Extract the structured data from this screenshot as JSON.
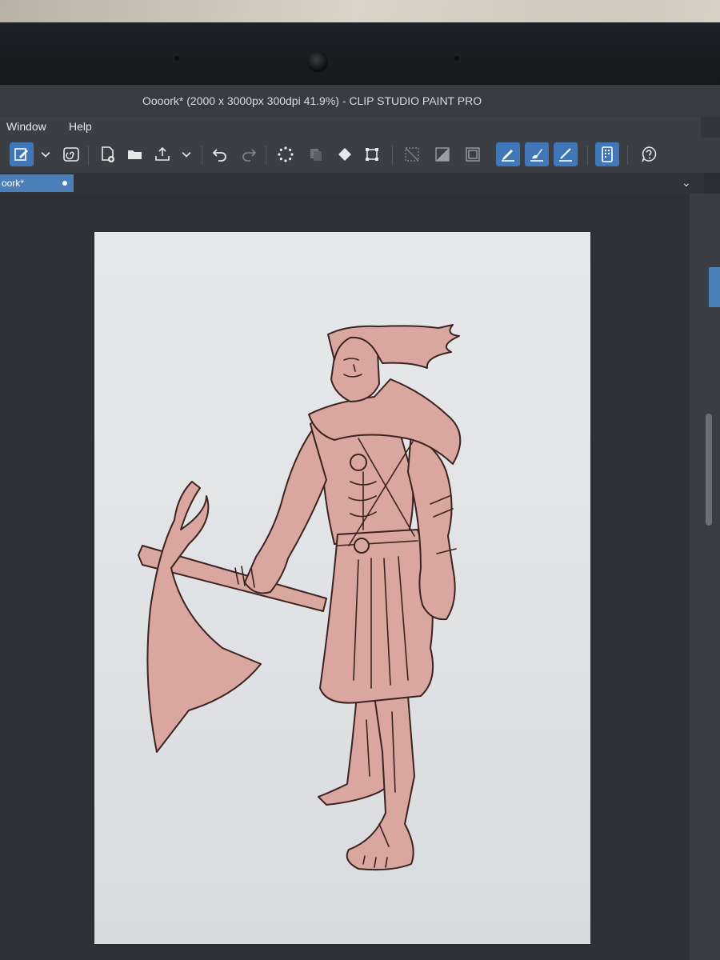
{
  "window": {
    "title": "Oooork* (2000 x 3000px 300dpi 41.9%)  - CLIP STUDIO PAINT PRO"
  },
  "menu": {
    "items": [
      "Window",
      "Help"
    ]
  },
  "document_tab": {
    "label": "oork*"
  },
  "toolbar": {
    "icons": [
      "edit-icon",
      "chevron-down-icon",
      "spiral-icon",
      "new-file-icon",
      "open-folder-icon",
      "export-icon",
      "chevron-down-icon",
      "undo-icon",
      "redo-icon",
      "loading-icon",
      "copy-icon",
      "fill-icon",
      "transform-icon",
      "deselect-icon",
      "selection-layer-icon",
      "selection-frame-icon",
      "pen-tool-icon",
      "brush-tool-icon",
      "line-tool-icon",
      "device-icon",
      "help-icon"
    ]
  },
  "colors": {
    "accent": "#3f77b8",
    "tab": "#4a7fb8",
    "artwork_fill": "#d9a7a0",
    "artwork_line": "#3b2320",
    "paper": "#e3e5e8"
  }
}
